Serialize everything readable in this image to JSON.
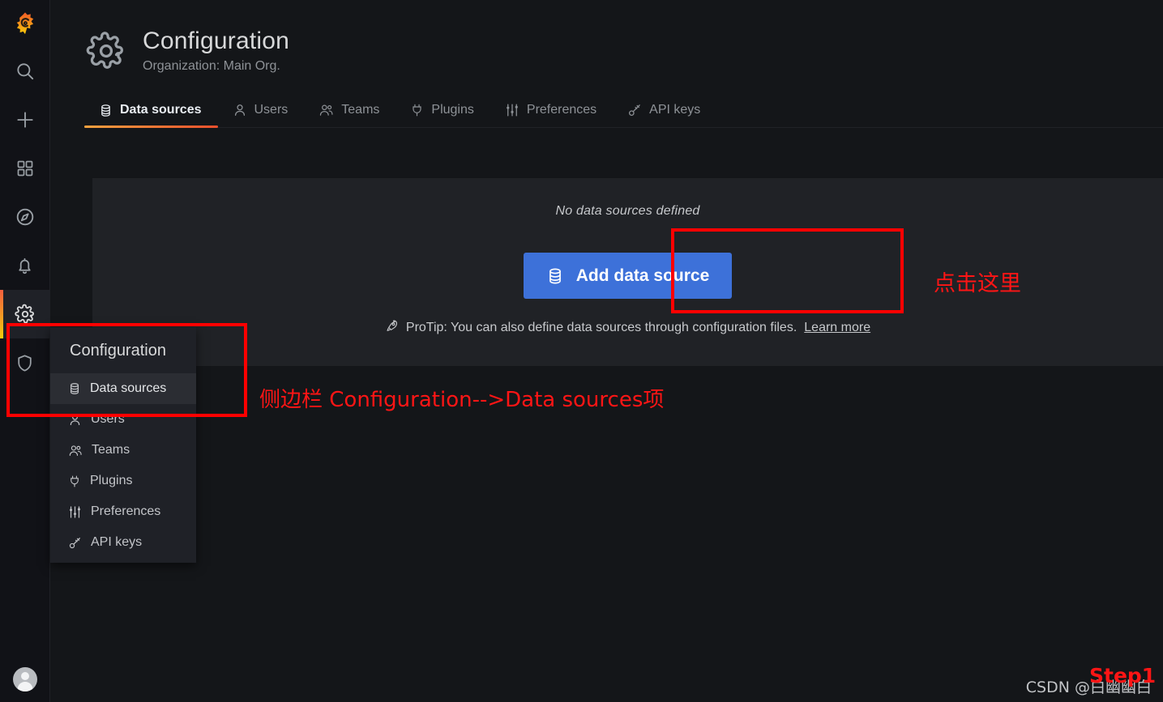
{
  "app": {
    "logo_icon": "grafana-logo-icon",
    "avatar_icon": "user-avatar-icon"
  },
  "rail": {
    "items": [
      {
        "name": "search",
        "icon": "search-icon",
        "active": false
      },
      {
        "name": "create",
        "icon": "plus-icon",
        "active": false
      },
      {
        "name": "dashboards",
        "icon": "apps-grid-icon",
        "active": false
      },
      {
        "name": "explore",
        "icon": "compass-icon",
        "active": false
      },
      {
        "name": "alerting",
        "icon": "bell-icon",
        "active": false
      },
      {
        "name": "configuration",
        "icon": "gear-icon",
        "active": true
      },
      {
        "name": "server-admin",
        "icon": "shield-icon",
        "active": false
      }
    ]
  },
  "header": {
    "icon": "gear-icon",
    "title": "Configuration",
    "subtitle": "Organization: Main Org."
  },
  "tabs": [
    {
      "label": "Data sources",
      "icon": "database-icon",
      "active": true
    },
    {
      "label": "Users",
      "icon": "user-icon",
      "active": false
    },
    {
      "label": "Teams",
      "icon": "users-icon",
      "active": false
    },
    {
      "label": "Plugins",
      "icon": "plug-icon",
      "active": false
    },
    {
      "label": "Preferences",
      "icon": "sliders-icon",
      "active": false
    },
    {
      "label": "API keys",
      "icon": "key-icon",
      "active": false
    }
  ],
  "main": {
    "empty_title": "No data sources defined",
    "add_button_label": "Add data source",
    "add_button_icon": "database-icon",
    "protip_icon": "rocket-icon",
    "protip_text": "ProTip: You can also define data sources through configuration files.",
    "protip_link": "Learn more"
  },
  "flyout": {
    "title": "Configuration",
    "items": [
      {
        "label": "Data sources",
        "icon": "database-icon",
        "selected": true
      },
      {
        "label": "Users",
        "icon": "user-icon",
        "selected": false
      },
      {
        "label": "Teams",
        "icon": "users-icon",
        "selected": false
      },
      {
        "label": "Plugins",
        "icon": "plug-icon",
        "selected": false
      },
      {
        "label": "Preferences",
        "icon": "sliders-icon",
        "selected": false
      },
      {
        "label": "API keys",
        "icon": "key-icon",
        "selected": false
      }
    ]
  },
  "annotations": {
    "click_here": "点击这里",
    "sidebar_hint": "侧边栏 Configuration-->Data sources项",
    "step_label": "Step1",
    "watermark": "CSDN @白幽幽白",
    "highlight_color": "#ff0000"
  }
}
